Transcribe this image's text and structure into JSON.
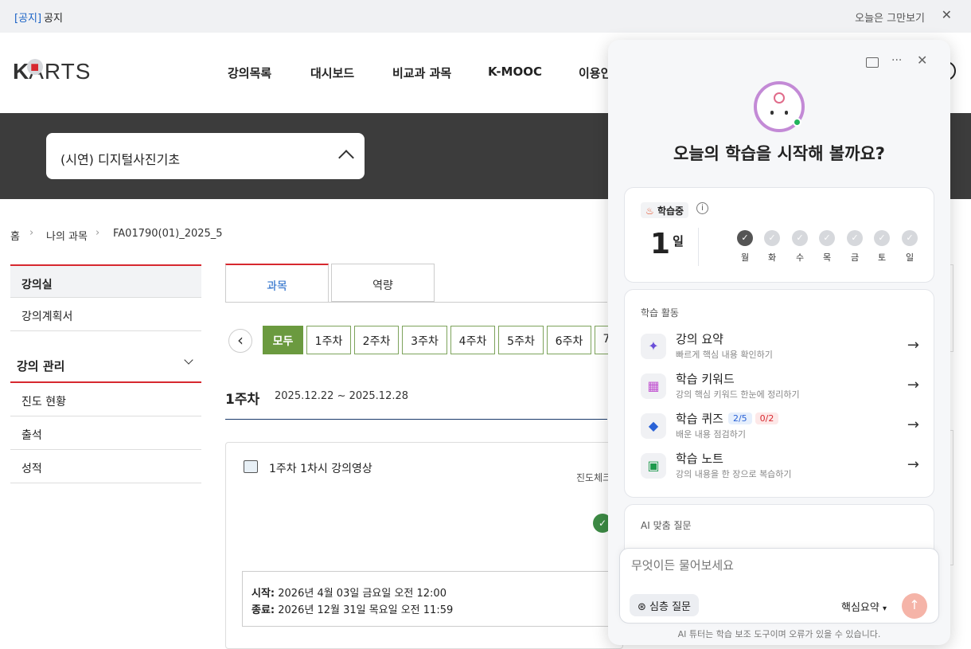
{
  "notice": {
    "tag": "[공지]",
    "text": "공지",
    "dismiss": "오늘은 그만보기",
    "close": "✕"
  },
  "header": {
    "logo": {
      "k": "K",
      "dot": "■",
      "arts": "ARTS"
    },
    "nav": [
      "강의목록",
      "대시보드",
      "비교과 과목",
      "K-MOOC",
      "이용인"
    ]
  },
  "course_select": {
    "value": "(시연) 디지털사진기초"
  },
  "breadcrumb": {
    "items": [
      "홈",
      "나의 과목",
      "FA01790(01)_2025_5"
    ],
    "sep": "›"
  },
  "sidebar": {
    "items": [
      "강의실",
      "강의계획서"
    ],
    "section": "강의 관리",
    "section_items": [
      "진도 현황",
      "출석",
      "성적"
    ]
  },
  "tabs": [
    "과목",
    "역량"
  ],
  "weeks": {
    "prev": "‹",
    "items": [
      "모두",
      "1주차",
      "2주차",
      "3주차",
      "4주차",
      "5주차",
      "6주차",
      "7"
    ]
  },
  "week_header": {
    "title": "1주차",
    "range": "2025.12.22 ~ 2025.12.28"
  },
  "lecture": {
    "title": "1주차 1차시 강의영상",
    "progress_label": "진도체크",
    "start_label": "시작:",
    "start": "2026년 4월 03일 금요일 오전 12:00",
    "end_label": "종료:",
    "end": "2026년 12월 31일 목요일 오전 11:59"
  },
  "ai_panel": {
    "greeting": "오늘의 학습을 시작해 볼까요?",
    "status": {
      "badge": "학습중",
      "streak": "1",
      "streak_unit": "일",
      "days": [
        "월",
        "화",
        "수",
        "목",
        "금",
        "토",
        "일"
      ],
      "done_count": 1
    },
    "activities_title": "학습 활동",
    "activities": [
      {
        "title": "강의 요약",
        "subtitle": "빠르게 핵심 내용 확인하기"
      },
      {
        "title": "학습 키워드",
        "subtitle": "강의 핵심 키워드 한눈에 정리하기"
      },
      {
        "title": "학습 퀴즈",
        "subtitle": "배운 내용 점검하기",
        "badge1": "2/5",
        "badge2": "0/2"
      },
      {
        "title": "학습 노트",
        "subtitle": "강의 내용을 한 장으로 복습하기"
      }
    ],
    "suggest_title": "AI 맞춤 질문",
    "input_placeholder": "무엇이든 물어보세요",
    "deep_question": "심층 질문",
    "mode": "핵심요약",
    "disclaimer": "AI 튜터는 학습 보조 도구이며 오류가 있을 수 있습니다."
  },
  "colors": {
    "accent_green": "#6b9a3f",
    "accent_red": "#d7282f",
    "link_blue": "#1a63c6"
  }
}
